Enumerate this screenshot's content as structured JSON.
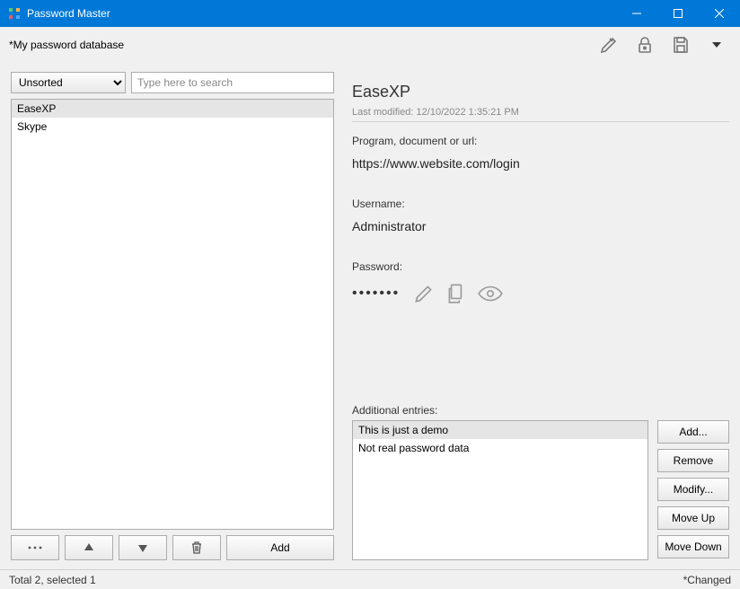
{
  "titlebar": {
    "title": "Password Master"
  },
  "toolbar": {
    "db_name": "*My password database"
  },
  "left": {
    "sort_value": "Unsorted",
    "search_placeholder": "Type here to search",
    "items": [
      {
        "label": "EaseXP",
        "selected": true
      },
      {
        "label": "Skype",
        "selected": false
      }
    ],
    "add_button": "Add"
  },
  "detail": {
    "title": "EaseXP",
    "last_modified": "Last modified: 12/10/2022 1:35:21 PM",
    "url_label": "Program, document or url:",
    "url_value": "https://www.website.com/login",
    "username_label": "Username:",
    "username_value": "Administrator",
    "password_label": "Password:",
    "password_mask": "•••••••",
    "additional_label": "Additional entries:",
    "additional_items": [
      {
        "label": "This is just a demo",
        "selected": true
      },
      {
        "label": "Not real password data",
        "selected": false
      }
    ],
    "buttons": {
      "add": "Add...",
      "remove": "Remove",
      "modify": "Modify...",
      "move_up": "Move Up",
      "move_down": "Move Down"
    }
  },
  "statusbar": {
    "left": "Total 2, selected 1",
    "right": "*Changed"
  }
}
